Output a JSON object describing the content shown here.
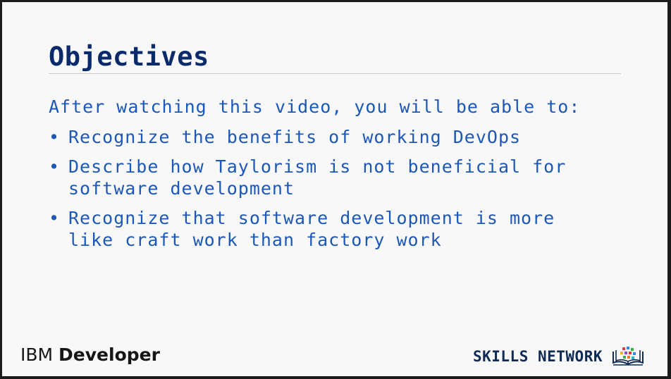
{
  "slide": {
    "title": "Objectives",
    "intro": "After watching this video, you will be able to:",
    "bullet_symbol": "•",
    "bullets": [
      "Recognize the benefits of working DevOps",
      "Describe how Taylorism is not beneficial for\nsoftware development",
      "Recognize that software development is more\nlike craft work than factory work"
    ]
  },
  "footer": {
    "ibm_prefix": "IBM ",
    "ibm_product": "Developer",
    "skills_network": "SKILLS NETWORK"
  },
  "colors": {
    "title": "#0a2a6b",
    "body_text": "#1d58b8",
    "slide_background": "#f7f8f7",
    "frame": "#1b1b1b"
  },
  "icons": {
    "skills_network_logo": "open-book-with-colored-squares-icon"
  }
}
